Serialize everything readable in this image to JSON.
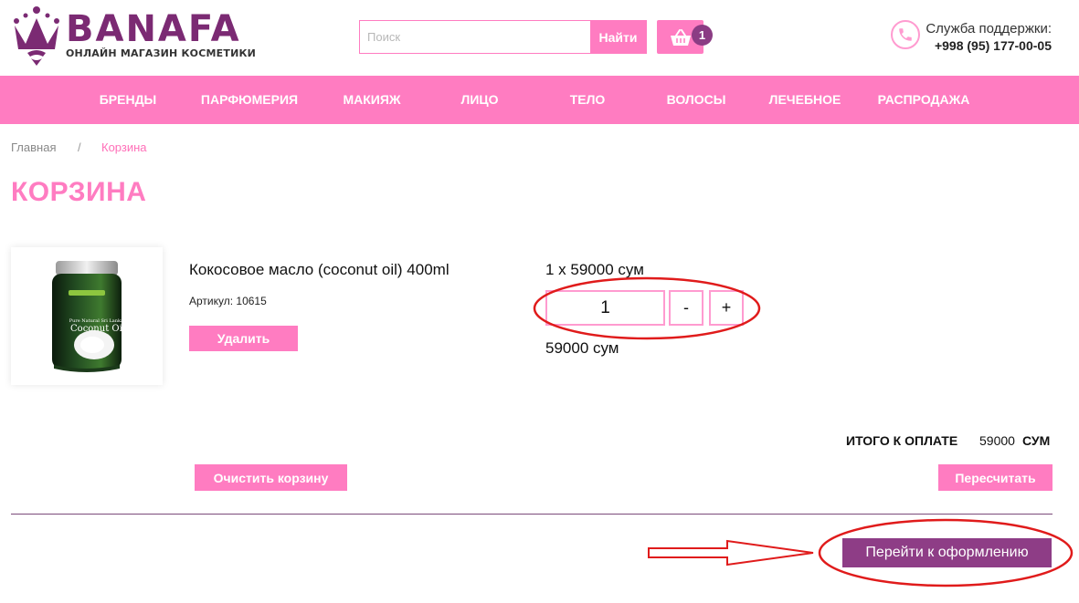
{
  "header": {
    "logo_text": "BANAFA",
    "logo_subtitle": "ОНЛАЙН МАГАЗИН КОСМЕТИКИ",
    "logo_icon": "crown-icon",
    "search": {
      "placeholder": "Поиск",
      "value": "",
      "button_label": "Найти"
    },
    "cart": {
      "icon": "basket-icon",
      "count": "1"
    },
    "support": {
      "icon": "phone-icon",
      "title": "Служба поддержки:",
      "phone": "+998 (95) 177-00-05"
    }
  },
  "nav": {
    "items": [
      {
        "label": "БРЕНДЫ"
      },
      {
        "label": "ПАРФЮМЕРИЯ"
      },
      {
        "label": "МАКИЯЖ"
      },
      {
        "label": "ЛИЦО"
      },
      {
        "label": "ТЕЛО"
      },
      {
        "label": "ВОЛОСЫ"
      },
      {
        "label": "ЛЕЧЕБНОЕ"
      },
      {
        "label": "РАСПРОДАЖА"
      }
    ]
  },
  "breadcrumb": {
    "home": "Главная",
    "separator": "/",
    "current": "Корзина"
  },
  "page_title": "КОРЗИНА",
  "cart_items": [
    {
      "image_text_1": "Pure Natural Sri Lankan",
      "image_text_2": "Coconut Oil",
      "name": "Кокосовое масло (coconut oil) 400ml",
      "article": "Артикул: 10615",
      "delete_label": "Удалить",
      "unit_price": "1 x 59000 сум",
      "quantity": "1",
      "minus_label": "-",
      "plus_label": "+",
      "line_total": "59000 сум"
    }
  ],
  "summary": {
    "total_label": "ИТОГО К ОПЛАТЕ",
    "total_value": "59000",
    "total_currency": "СУМ",
    "clear_label": "Очистить корзину",
    "recalc_label": "Пересчитать",
    "checkout_label": "Перейти к оформлению"
  },
  "colors": {
    "accent_pink": "#ff7cc1",
    "brand_purple": "#7b2a73",
    "checkout_purple": "#8e3d86",
    "annotation_red": "#e01b1b"
  }
}
